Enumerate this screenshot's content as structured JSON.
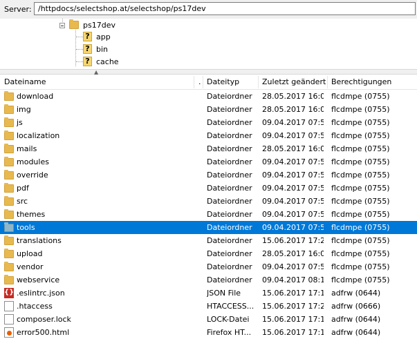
{
  "server": {
    "label": "Server:",
    "path": "/httpdocs/selectshop.at/selectshop/ps17dev"
  },
  "tree": {
    "parent": "ps17dev",
    "children": [
      "app",
      "bin",
      "cache"
    ],
    "child_icon": "question-mark-icon"
  },
  "columns": {
    "name": "Dateiname",
    "ext": ".",
    "type": "Dateityp",
    "date": "Zuletzt geändert",
    "perm": "Berechtigungen"
  },
  "colors": {
    "selection": "#0078d7",
    "folder": "#e7b94f"
  },
  "files": [
    {
      "name": "download",
      "type": "Dateiordner",
      "date": "28.05.2017 16:0...",
      "perm": "flcdmpe (0755)",
      "icon": "folder-icon"
    },
    {
      "name": "img",
      "type": "Dateiordner",
      "date": "28.05.2017 16:0...",
      "perm": "flcdmpe (0755)",
      "icon": "folder-icon"
    },
    {
      "name": "js",
      "type": "Dateiordner",
      "date": "09.04.2017 07:5...",
      "perm": "flcdmpe (0755)",
      "icon": "folder-icon"
    },
    {
      "name": "localization",
      "type": "Dateiordner",
      "date": "09.04.2017 07:5...",
      "perm": "flcdmpe (0755)",
      "icon": "folder-icon"
    },
    {
      "name": "mails",
      "type": "Dateiordner",
      "date": "28.05.2017 16:0...",
      "perm": "flcdmpe (0755)",
      "icon": "folder-icon"
    },
    {
      "name": "modules",
      "type": "Dateiordner",
      "date": "09.04.2017 07:5...",
      "perm": "flcdmpe (0755)",
      "icon": "folder-icon"
    },
    {
      "name": "override",
      "type": "Dateiordner",
      "date": "09.04.2017 07:5...",
      "perm": "flcdmpe (0755)",
      "icon": "folder-icon"
    },
    {
      "name": "pdf",
      "type": "Dateiordner",
      "date": "09.04.2017 07:5...",
      "perm": "flcdmpe (0755)",
      "icon": "folder-icon"
    },
    {
      "name": "src",
      "type": "Dateiordner",
      "date": "09.04.2017 07:5...",
      "perm": "flcdmpe (0755)",
      "icon": "folder-icon"
    },
    {
      "name": "themes",
      "type": "Dateiordner",
      "date": "09.04.2017 07:5...",
      "perm": "flcdmpe (0755)",
      "icon": "folder-icon"
    },
    {
      "name": "tools",
      "type": "Dateiordner",
      "date": "09.04.2017 07:5...",
      "perm": "flcdmpe (0755)",
      "icon": "folder-icon",
      "selected": true
    },
    {
      "name": "translations",
      "type": "Dateiordner",
      "date": "15.06.2017 17:2...",
      "perm": "flcdmpe (0755)",
      "icon": "folder-icon"
    },
    {
      "name": "upload",
      "type": "Dateiordner",
      "date": "28.05.2017 16:0...",
      "perm": "flcdmpe (0755)",
      "icon": "folder-icon"
    },
    {
      "name": "vendor",
      "type": "Dateiordner",
      "date": "09.04.2017 07:5...",
      "perm": "flcdmpe (0755)",
      "icon": "folder-icon"
    },
    {
      "name": "webservice",
      "type": "Dateiordner",
      "date": "09.04.2017 08:1...",
      "perm": "flcdmpe (0755)",
      "icon": "folder-icon"
    },
    {
      "name": ".eslintrc.json",
      "type": "JSON File",
      "date": "15.06.2017 17:1...",
      "perm": "adfrw (0644)",
      "icon": "json-file-icon"
    },
    {
      "name": ".htaccess",
      "type": "HTACCESS...",
      "date": "15.06.2017 17:2...",
      "perm": "adfrw (0666)",
      "icon": "file-icon"
    },
    {
      "name": "composer.lock",
      "type": "LOCK-Datei",
      "date": "15.06.2017 17:1...",
      "perm": "adfrw (0644)",
      "icon": "file-icon"
    },
    {
      "name": "error500.html",
      "type": "Firefox HT...",
      "date": "15.06.2017 17:1...",
      "perm": "adfrw (0644)",
      "icon": "firefox-html-icon"
    }
  ]
}
